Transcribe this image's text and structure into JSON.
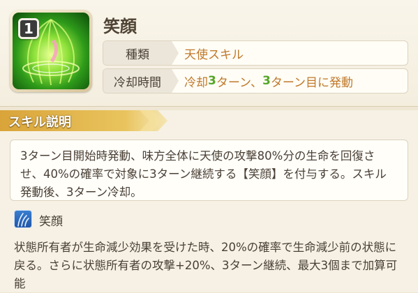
{
  "skill": {
    "level": "1",
    "name": "笑顔",
    "type_label": "種類",
    "type_value": "天使スキル",
    "cooldown_label": "冷却時間",
    "cooldown_prefix": "冷却",
    "cooldown_turns": "3",
    "cooldown_middle": "ターン、",
    "trigger_turn": "3",
    "cooldown_suffix": "ターン目に発動",
    "icon": "green-dome-skill-icon"
  },
  "description": {
    "header": "スキル説明",
    "text": "3ターン目開始時発動、味方全体に天使の攻撃80%分の生命を回復させ、40%の確率で対象に3ターン継続する【笑顔】を付与する。スキル発動後、3ターン冷却。"
  },
  "effect": {
    "icon": "blue-wind-effect-icon",
    "name": "笑顔",
    "text": "状態所有者が生命減少効果を受けた時、20%の確率で生命減少前の状態に戻る。さらに状態所有者の攻撃+20%、3ターン継続、最大3個まで加算可能"
  },
  "colors": {
    "accent_orange": "#c0792b",
    "accent_green": "#56a629",
    "header_gold": "#e3b54a"
  }
}
